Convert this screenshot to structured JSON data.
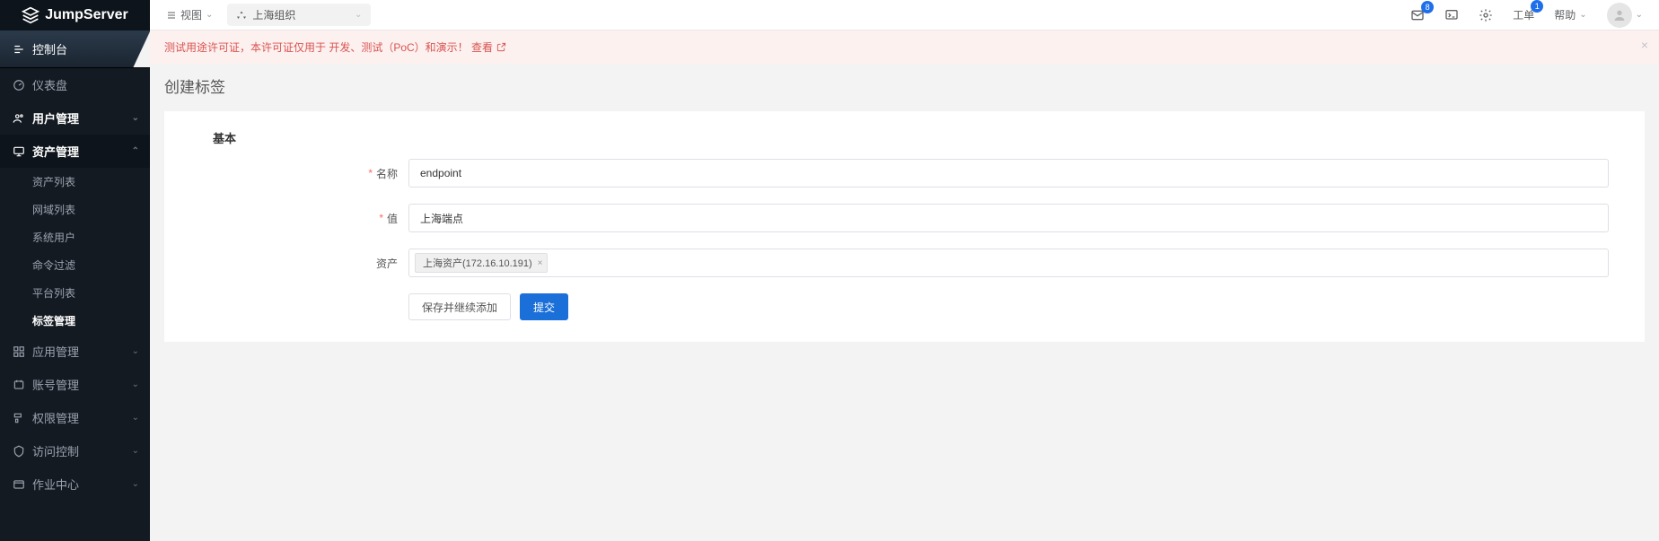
{
  "brand": "JumpServer",
  "sidebar": {
    "console": "控制台",
    "items": [
      {
        "label": "仪表盘",
        "icon": "dashboard-icon"
      },
      {
        "label": "用户管理",
        "icon": "users-icon",
        "chev": true,
        "bold": true
      },
      {
        "label": "资产管理",
        "icon": "assets-icon",
        "chev": true,
        "bold": true,
        "active": true,
        "subitems": [
          {
            "label": "资产列表"
          },
          {
            "label": "网域列表"
          },
          {
            "label": "系统用户"
          },
          {
            "label": "命令过滤"
          },
          {
            "label": "平台列表"
          },
          {
            "label": "标签管理",
            "active": true
          }
        ]
      },
      {
        "label": "应用管理",
        "icon": "apps-icon",
        "chev": true
      },
      {
        "label": "账号管理",
        "icon": "account-icon",
        "chev": true
      },
      {
        "label": "权限管理",
        "icon": "perm-icon",
        "chev": true
      },
      {
        "label": "访问控制",
        "icon": "access-icon",
        "chev": true
      },
      {
        "label": "作业中心",
        "icon": "jobs-icon",
        "chev": true
      }
    ]
  },
  "topbar": {
    "view_label": "视图",
    "org_selected": "上海组织",
    "mail_badge": "8",
    "ticket_label": "工单",
    "ticket_badge": "1",
    "help_label": "帮助"
  },
  "alert": {
    "text": "测试用途许可证，本许可证仅用于 开发、测试（PoC）和演示！",
    "link_label": "查看"
  },
  "page": {
    "title": "创建标签"
  },
  "form": {
    "section": "基本",
    "name_label": "名称",
    "name_value": "endpoint",
    "value_label": "值",
    "value_value": "上海端点",
    "asset_label": "资产",
    "asset_tags": [
      "上海资产(172.16.10.191)"
    ],
    "save_continue": "保存并继续添加",
    "submit": "提交"
  }
}
